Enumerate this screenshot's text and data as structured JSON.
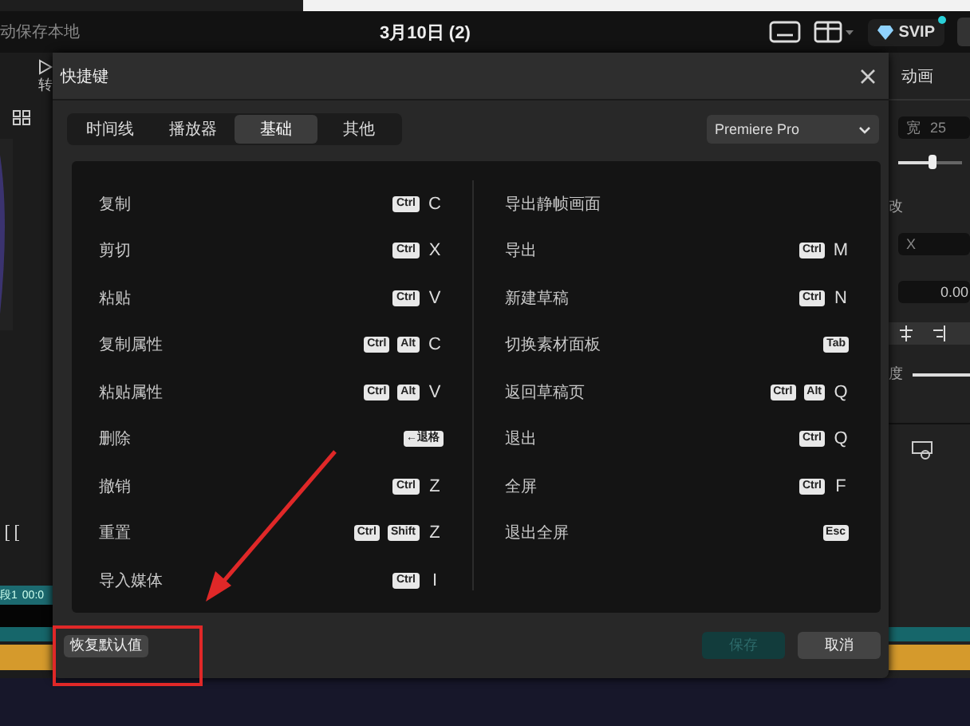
{
  "topbar": {
    "autosave": "动保存本地",
    "project_title": "3月10日 (2)",
    "vip_badge": "SVIP"
  },
  "left_strip": {
    "labels": [
      "转"
    ],
    "clip_label": "段1",
    "clip_time": "00:0"
  },
  "right_strip": {
    "tab": "动画",
    "width_label": "宽",
    "width_value": "25",
    "scale_label": "改",
    "x_label": "X",
    "value": "0.00",
    "opacity_label": "度",
    "size_slider": {
      "level": 0.55
    },
    "opacity_slider": {
      "level": 1
    }
  },
  "dialog": {
    "title": "快捷键",
    "tabs": [
      {
        "label": "时间线",
        "selected": false
      },
      {
        "label": "播放器",
        "selected": false
      },
      {
        "label": "基础",
        "selected": true
      },
      {
        "label": "其他",
        "selected": false
      }
    ],
    "preset": "Premiere Pro",
    "columns": [
      [
        {
          "action": "复制",
          "keys": [
            {
              "label": "Ctrl",
              "kind": "cap"
            },
            {
              "label": "C",
              "kind": "letter"
            }
          ]
        },
        {
          "action": "剪切",
          "keys": [
            {
              "label": "Ctrl",
              "kind": "cap"
            },
            {
              "label": "X",
              "kind": "letter"
            }
          ]
        },
        {
          "action": "粘贴",
          "keys": [
            {
              "label": "Ctrl",
              "kind": "cap"
            },
            {
              "label": "V",
              "kind": "letter"
            }
          ]
        },
        {
          "action": "复制属性",
          "keys": [
            {
              "label": "Ctrl",
              "kind": "cap"
            },
            {
              "label": "Alt",
              "kind": "cap"
            },
            {
              "label": "C",
              "kind": "letter"
            }
          ]
        },
        {
          "action": "粘贴属性",
          "keys": [
            {
              "label": "Ctrl",
              "kind": "cap"
            },
            {
              "label": "Alt",
              "kind": "cap"
            },
            {
              "label": "V",
              "kind": "letter"
            }
          ]
        },
        {
          "action": "删除",
          "keys": [
            {
              "label": "←退格",
              "kind": "cap"
            }
          ]
        },
        {
          "action": "撤销",
          "keys": [
            {
              "label": "Ctrl",
              "kind": "cap"
            },
            {
              "label": "Z",
              "kind": "letter"
            }
          ]
        },
        {
          "action": "重置",
          "keys": [
            {
              "label": "Ctrl",
              "kind": "cap"
            },
            {
              "label": "Shift",
              "kind": "cap"
            },
            {
              "label": "Z",
              "kind": "letter"
            }
          ]
        },
        {
          "action": "导入媒体",
          "keys": [
            {
              "label": "Ctrl",
              "kind": "cap"
            },
            {
              "label": "I",
              "kind": "letter"
            }
          ]
        }
      ],
      [
        {
          "action": "导出静帧画面"
        },
        {
          "action": "导出",
          "keys": [
            {
              "label": "Ctrl",
              "kind": "cap"
            },
            {
              "label": "M",
              "kind": "letter"
            }
          ]
        },
        {
          "action": "新建草稿",
          "keys": [
            {
              "label": "Ctrl",
              "kind": "cap"
            },
            {
              "label": "N",
              "kind": "letter"
            }
          ]
        },
        {
          "action": "切换素材面板",
          "keys": [
            {
              "label": "Tab",
              "kind": "cap"
            }
          ]
        },
        {
          "action": "返回草稿页",
          "keys": [
            {
              "label": "Ctrl",
              "kind": "cap"
            },
            {
              "label": "Alt",
              "kind": "cap"
            },
            {
              "label": "Q",
              "kind": "letter"
            }
          ]
        },
        {
          "action": "退出",
          "keys": [
            {
              "label": "Ctrl",
              "kind": "cap"
            },
            {
              "label": "Q",
              "kind": "letter"
            }
          ]
        },
        {
          "action": "全屏",
          "keys": [
            {
              "label": "Ctrl",
              "kind": "cap"
            },
            {
              "label": "F",
              "kind": "letter"
            }
          ]
        },
        {
          "action": "退出全屏",
          "keys": [
            {
              "label": "Esc",
              "kind": "cap"
            }
          ]
        }
      ]
    ],
    "reset_button": "恢复默认值",
    "buttons": [
      {
        "label": "保存",
        "disabled": true
      },
      {
        "label": "取消",
        "disabled": false
      }
    ]
  }
}
